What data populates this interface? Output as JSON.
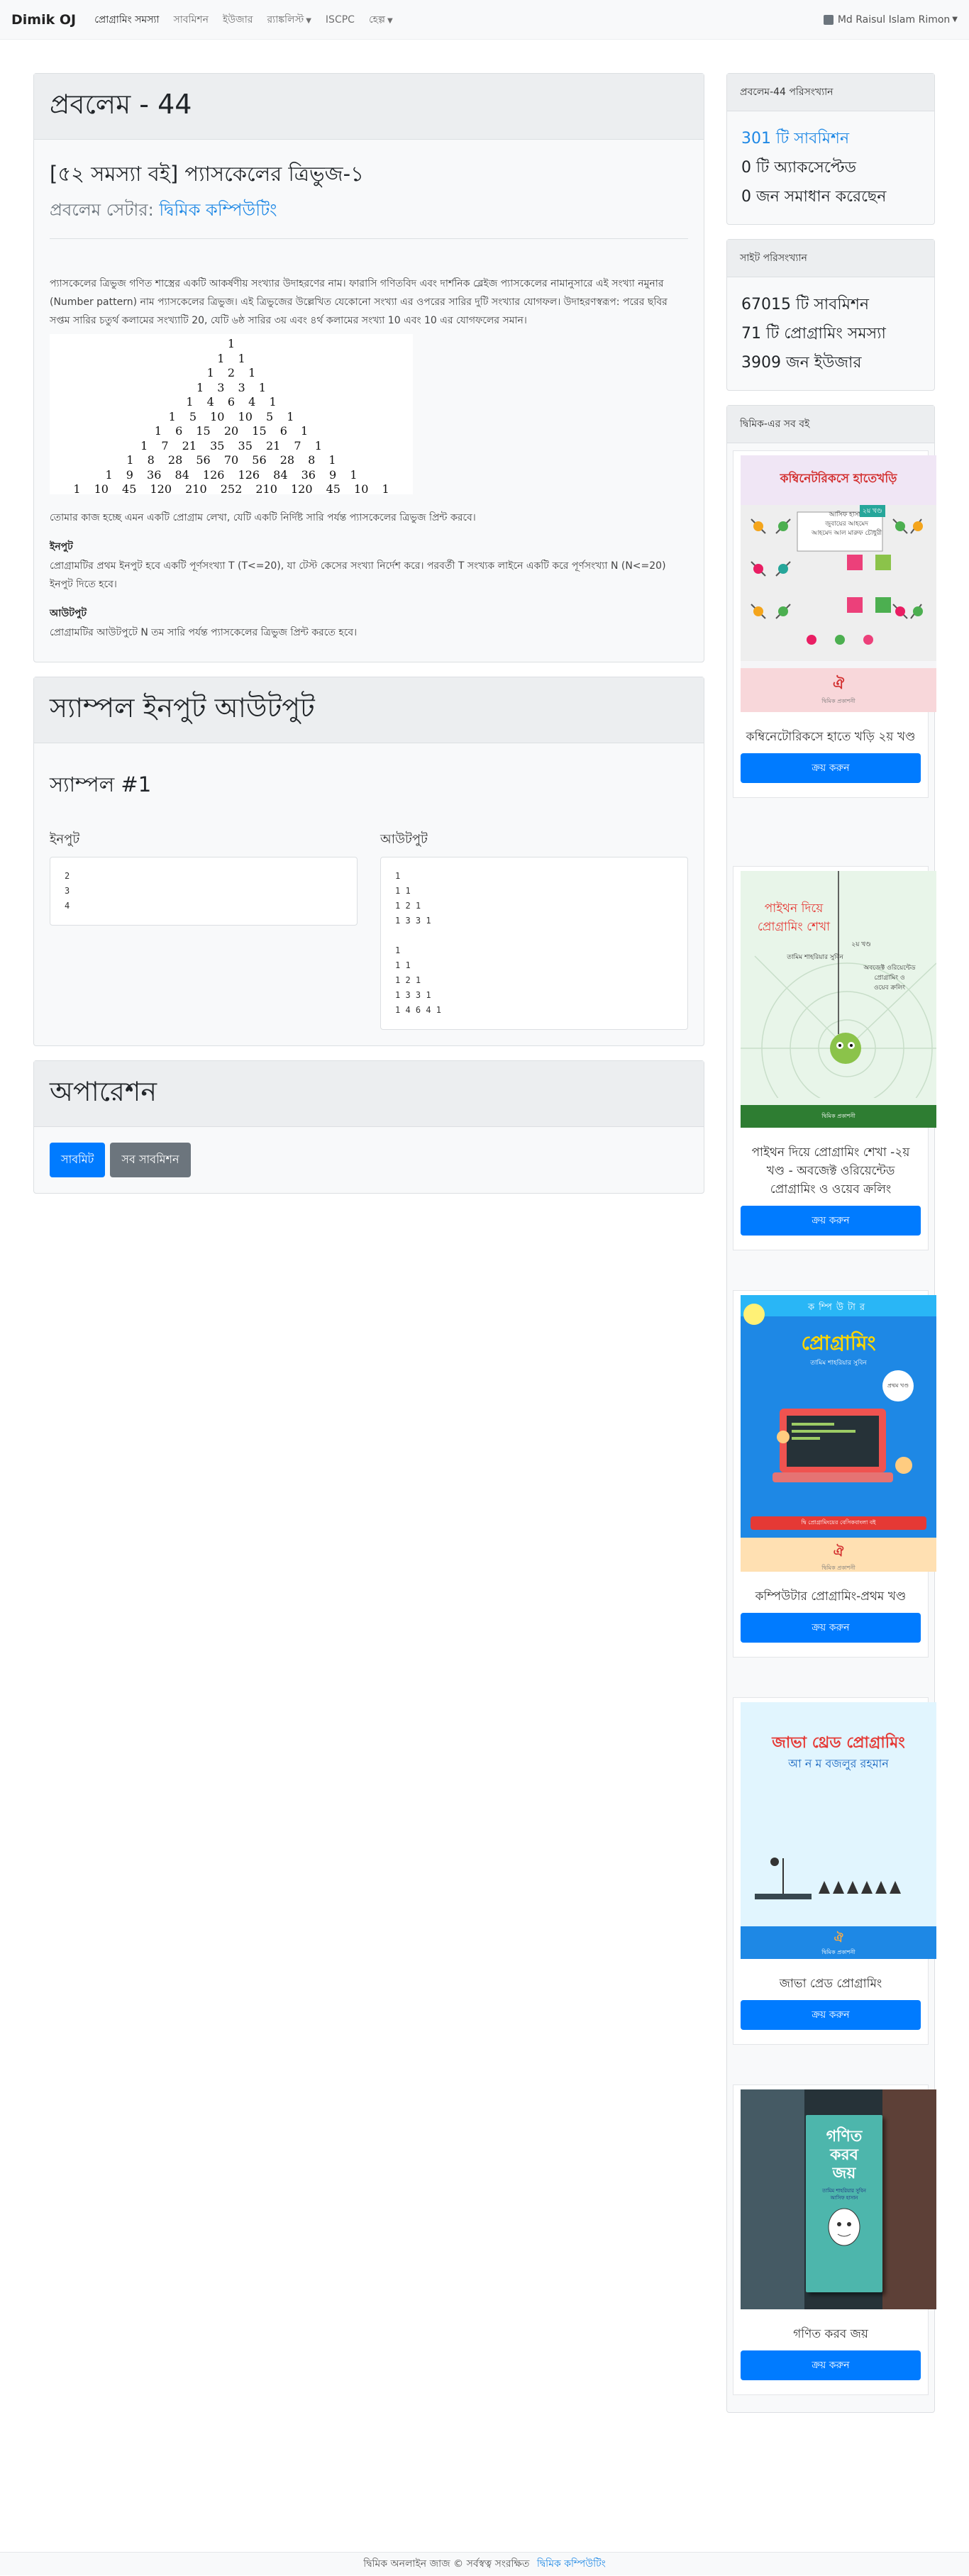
{
  "navbar": {
    "brand": "Dimik OJ",
    "links": [
      {
        "label": "প্রোগ্রামিং সমস্যা",
        "dropdown": false
      },
      {
        "label": "সাবমিশন",
        "dropdown": false
      },
      {
        "label": "ইউজার",
        "dropdown": false
      },
      {
        "label": "র‍্যাঙ্কলিস্ট",
        "dropdown": true
      },
      {
        "label": "ISCPC",
        "dropdown": false
      },
      {
        "label": "হেল্প",
        "dropdown": true
      }
    ],
    "user": "Md Raisul Islam Rimon"
  },
  "problem": {
    "header": "প্রবলেম - 44",
    "title": "[৫২ সমস্যা বই] প্যাসকেলের ত্রিভুজ-১",
    "setter_label": "প্রবলেম সেটার:",
    "setter_name": "দ্বিমিক কম্পিউটিং",
    "description": "প্যাসকেলের ত্রিভুজ গণিত শাস্ত্রের একটি আকর্ষণীয় সংখ্যার উদাহরণের নাম। ফারাসি গণিতবিদ এবং দার্শনিক ব্লেইজ প্যাসকেলের নামানুসারে এই সংখ্যা নমুনার (Number pattern) নাম প্যাসকেলের ত্রিভুজ। এই ত্রিভুজের উল্লেখিত যেকোনো সংখ্যা এর ওপরের সারির দুটি সংখ্যার যোগফল। উদাহরণস্বরূপ: পরের ছবির সপ্তম সারির চতুর্থ কলামের সংখ্যাটি 20, যেটি ৬ষ্ঠ সারির ৩য় এবং ৪র্থ কলামের সংখ্যা 10 এবং 10 এর যোগফলের সমান।",
    "triangle_rows": [
      "1",
      "1 1",
      "1 2 1",
      "1 3 3 1",
      "1 4 6 4 1",
      "1 5 10 10 5 1",
      "1 6 15 20 15 6 1",
      "1 7 21 35 35 21 7 1",
      "1 8 28 56 70 56 28 8 1",
      "1 9 36 84 126 126 84 36 9 1",
      "1 10 45 120 210 252 210 120 45 10 1"
    ],
    "task": "তোমার কাজ হচ্ছে এমন একটি প্রোগ্রাম লেখা, যেটি একটি নির্দিষ্ট সারি পর্যন্ত প্যাসকেলের ত্রিভুজ প্রিন্ট করবে।",
    "input_label": "ইনপুট",
    "input_text": "প্রোগ্রামটির প্রথম ইনপুট হবে একটি পূর্ণসংখ্যা T (T<=20), যা টেস্ট কেসের সংখ্যা নির্দেশ করে। পরবর্তী T সংখ্যক লাইনে একটি করে পূর্ণসংখ্যা N (N<=20) ইনপুট দিতে হবে।",
    "output_label": "আউটপুট",
    "output_text": "প্রোগ্রামটির আউটপুটে N তম সারি পর্যন্ত প্যাসকেলের ত্রিভুজ প্রিন্ট করতে হবে।"
  },
  "sample": {
    "header": "স্যাম্পল ইনপুট আউটপুট",
    "title": "স্যাম্পল #1",
    "input_label": "ইনপুট",
    "output_label": "আউটপুট",
    "input": "2\n3\n4",
    "output": "1\n1 1\n1 2 1\n1 3 3 1\n\n1\n1 1\n1 2 1\n1 3 3 1\n1 4 6 4 1"
  },
  "operation": {
    "header": "অপারেশন",
    "submit_label": "সাবমিট",
    "all_submissions_label": "সব সাবমিশন"
  },
  "problem_stats": {
    "header": "প্রবলেম-44 পরিসংখ্যান",
    "submissions": "301 টি সাবমিশন",
    "accepted": "0 টি অ্যাকসেপ্টেড",
    "solved": "0 জন সমাধান করেছেন"
  },
  "site_stats": {
    "header": "সাইট পরিসংখ্যান",
    "submissions": "67015 টি সাবমিশন",
    "problems": "71 টি প্রোগ্রামিং সমস্যা",
    "users": "3909 জন ইউজার"
  },
  "books": {
    "header": "দ্বিমিক-এর সব বই",
    "buy_label": "ক্রয় করুন",
    "items": [
      {
        "title": "কম্বিনেটোরিকসে হাতে খড়ি ২য় খণ্ড",
        "cover_title": "কম্বিনেটরিকসে হাতেখড়ি",
        "cover_tag": "২য় খণ্ড",
        "cover_author": "আসিফ হাসান\nজুবায়ের আহমেদ\nআহমেদ আল মারুফ চৌধুরী"
      },
      {
        "title": "পাইথন দিয়ে প্রোগ্রামিং শেখা -২য় খণ্ড - অবজেক্ট ওরিয়েন্টেড প্রোগ্রামিং ও ওয়েব ক্রলিং",
        "cover_title": "পাইথন দিয়ে\nপ্রোগ্রামিং শেখা",
        "cover_tag": "২য় খণ্ড",
        "cover_author": "তামিম শাহরিয়ার সুবিন",
        "cover_sub": "অবজেক্ট ওরিয়েন্টেড\nপ্রোগ্রামিং ও\nওয়েব ক্রলিং"
      },
      {
        "title": "কম্পিউটার প্রোগ্রামিং-প্রথম খণ্ড",
        "cover_title": "প্রোগ্রামিং",
        "cover_top": "কম্পিউটার",
        "cover_tag": "প্রথম খণ্ড",
        "cover_author": "তামিম শাহরিয়ার সুবিন",
        "cover_note": "দ্বি প্রোগ্রামিংয়ের বেসিকবাংলা বই"
      },
      {
        "title": "জাভা প্রেড প্রোগ্রামিং",
        "cover_title": "জাভা থ্রেড প্রোগ্রামিং",
        "cover_author": "আ ন ম বজলুর রহমান"
      },
      {
        "title": "গণিত করব জয়",
        "cover_title": "গণিত\nকরব\nজয়",
        "cover_author": "তামিম শাহরিয়ার সুবিন\nআসিফ হাসান"
      }
    ],
    "publisher_label": "দ্বিমিক প্রকাশনী"
  },
  "footer": {
    "text": "দ্বিমিক অনলাইন জাজ © সর্বস্বত্ব সংরক্ষিত",
    "link": "দ্বিমিক কম্পিউটিং"
  },
  "colors": {
    "primary": "#007bff",
    "secondary": "#6c757d",
    "link": "#1e88e5"
  }
}
